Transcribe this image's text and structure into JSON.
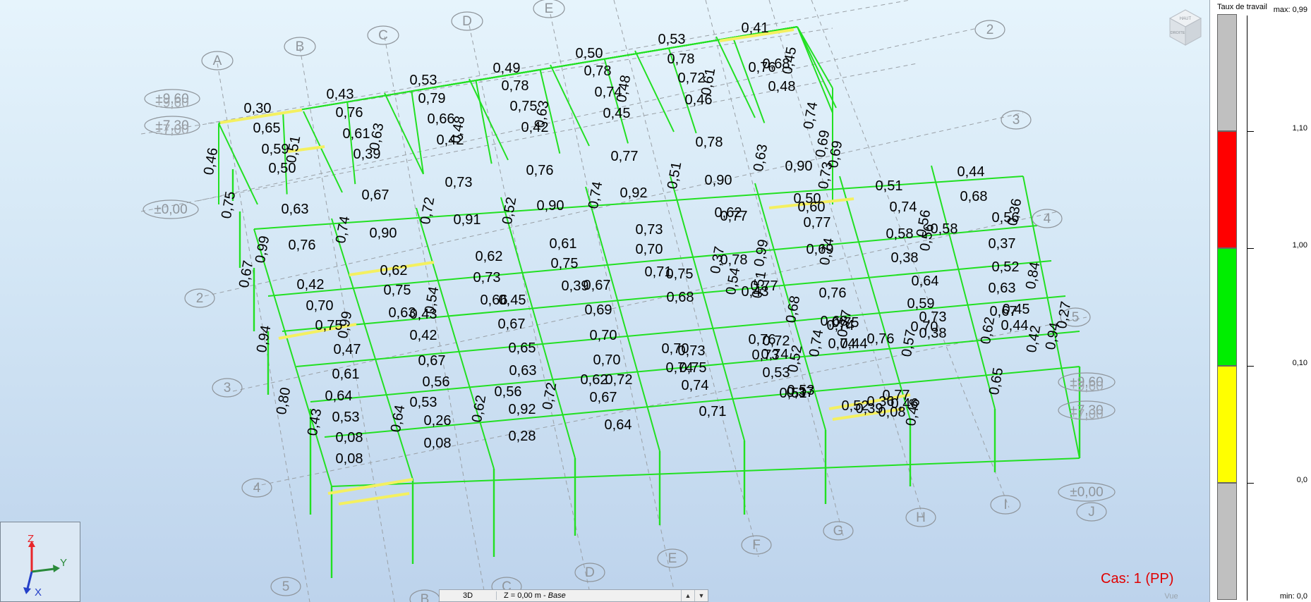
{
  "viewport": {
    "case_label": "Cas: 1 (PP)",
    "view_tab": "Vue",
    "viewcube": {
      "front_face": "DROITE",
      "top_face": "HAUT"
    }
  },
  "status": {
    "mode": "3D",
    "level_prefix": "Z = 0,00 m - ",
    "level_name": "Base"
  },
  "legend": {
    "title": "Taux de travail",
    "max_label": "max: 0,99",
    "min_label": "min: 0,0",
    "ticks": [
      "1,10",
      "1,00",
      "0,10",
      "0,0"
    ],
    "colors": {
      "over": "#ff0000",
      "ok": "#00ee00",
      "low": "#ffff00",
      "neutral": "#c0c0c0"
    }
  },
  "axes": {
    "z": "Z",
    "y": "Y",
    "x": "X"
  },
  "grid_labels": {
    "left_letters": [
      "A",
      "B",
      "C",
      "D",
      "E"
    ],
    "bottom_letters": [
      "B",
      "C",
      "D",
      "E",
      "F",
      "G",
      "H",
      "I",
      "J"
    ],
    "left_numbers": [
      "2",
      "3",
      "4",
      "5"
    ],
    "right_numbers": [
      "2",
      "3",
      "4",
      "5"
    ],
    "level_tags_left": [
      "±9,60",
      "±7,30",
      "±0,00"
    ],
    "level_tags_left_ghost": [
      "±9,60",
      "±7,00"
    ],
    "level_tags_right": [
      "±9,60",
      "±7,30",
      "±0,00"
    ],
    "level_tags_right_ghost": [
      "±9,60",
      "±7,00"
    ]
  },
  "ratios": [
    {
      "t": "0,30"
    },
    {
      "t": "0,43"
    },
    {
      "t": "0,53"
    },
    {
      "t": "0,49"
    },
    {
      "t": "0,50"
    },
    {
      "t": "0,53"
    },
    {
      "t": "0,41"
    },
    {
      "t": "0,65"
    },
    {
      "t": "0,76"
    },
    {
      "t": "0,79"
    },
    {
      "t": "0,78"
    },
    {
      "t": "0,78"
    },
    {
      "t": "0,78"
    },
    {
      "t": "0,76"
    },
    {
      "t": "0,59"
    },
    {
      "t": "0,61"
    },
    {
      "t": "0,66"
    },
    {
      "t": "0,75"
    },
    {
      "t": "0,74"
    },
    {
      "t": "0,72"
    },
    {
      "t": "0,68"
    },
    {
      "t": "0,50"
    },
    {
      "t": "0,39"
    },
    {
      "t": "0,42"
    },
    {
      "t": "0,42"
    },
    {
      "t": "0,45"
    },
    {
      "t": "0,46"
    },
    {
      "t": "0,48"
    },
    {
      "t": "0,51"
    },
    {
      "t": "0,63"
    },
    {
      "t": "0,48"
    },
    {
      "t": "0,63"
    },
    {
      "t": "0,48"
    },
    {
      "t": "0,61"
    },
    {
      "t": "0,45"
    },
    {
      "t": "0,46"
    },
    {
      "t": "0,74"
    },
    {
      "t": "0,69"
    },
    {
      "t": "0,69"
    },
    {
      "t": "0,73"
    },
    {
      "t": "0,76"
    },
    {
      "t": "0,77"
    },
    {
      "t": "0,78"
    },
    {
      "t": "0,63"
    },
    {
      "t": "0,90"
    },
    {
      "t": "0,73"
    },
    {
      "t": "0,75"
    },
    {
      "t": "0,63"
    },
    {
      "t": "0,67"
    },
    {
      "t": "0,72"
    },
    {
      "t": "0,52"
    },
    {
      "t": "0,74"
    },
    {
      "t": "0,92"
    },
    {
      "t": "0,51"
    },
    {
      "t": "0,90"
    },
    {
      "t": "0,99"
    },
    {
      "t": "0,76"
    },
    {
      "t": "0,74"
    },
    {
      "t": "0,90"
    },
    {
      "t": "0,91"
    },
    {
      "t": "0,90"
    },
    {
      "t": "0,62"
    },
    {
      "t": "0,60"
    },
    {
      "t": "0,50"
    },
    {
      "t": "0,51"
    },
    {
      "t": "0,44"
    },
    {
      "t": "0,74"
    },
    {
      "t": "0,68"
    },
    {
      "t": "0,77"
    },
    {
      "t": "0,58"
    },
    {
      "t": "0,56"
    },
    {
      "t": "0,56"
    },
    {
      "t": "0,36"
    },
    {
      "t": "0,67"
    },
    {
      "t": "0,62"
    },
    {
      "t": "0,62"
    },
    {
      "t": "0,61"
    },
    {
      "t": "0,73"
    },
    {
      "t": "0,77"
    },
    {
      "t": "0,69"
    },
    {
      "t": "0,74"
    },
    {
      "t": "0,38"
    },
    {
      "t": "0,37"
    },
    {
      "t": "0,42"
    },
    {
      "t": "0,75"
    },
    {
      "t": "0,73"
    },
    {
      "t": "0,75"
    },
    {
      "t": "0,70"
    },
    {
      "t": "0,37"
    },
    {
      "t": "0,78"
    },
    {
      "t": "0,99"
    },
    {
      "t": "0,56"
    },
    {
      "t": "0,58"
    },
    {
      "t": "0,70"
    },
    {
      "t": "0,63"
    },
    {
      "t": "0,66"
    },
    {
      "t": "0,39"
    },
    {
      "t": "0,71"
    },
    {
      "t": "0,54"
    },
    {
      "t": "0,43"
    },
    {
      "t": "0,51"
    },
    {
      "t": "0,76"
    },
    {
      "t": "0,64"
    },
    {
      "t": "0,52"
    },
    {
      "t": "0,84"
    },
    {
      "t": "0,94"
    },
    {
      "t": "0,75"
    },
    {
      "t": "0,99"
    },
    {
      "t": "0,54"
    },
    {
      "t": "0,43"
    },
    {
      "t": "0,45"
    },
    {
      "t": "0,67"
    },
    {
      "t": "0,75"
    },
    {
      "t": "0,68"
    },
    {
      "t": "0,59"
    },
    {
      "t": "0,63"
    },
    {
      "t": "0,27"
    },
    {
      "t": "0,47"
    },
    {
      "t": "0,42"
    },
    {
      "t": "0,67"
    },
    {
      "t": "0,69"
    },
    {
      "t": "0,68"
    },
    {
      "t": "0,77"
    },
    {
      "t": "0,74"
    },
    {
      "t": "0,70"
    },
    {
      "t": "0,67"
    },
    {
      "t": "0,94"
    },
    {
      "t": "0,80"
    },
    {
      "t": "0,61"
    },
    {
      "t": "0,67"
    },
    {
      "t": "0,65"
    },
    {
      "t": "0,70"
    },
    {
      "t": "0,70"
    },
    {
      "t": "0,76"
    },
    {
      "t": "0,74"
    },
    {
      "t": "0,74"
    },
    {
      "t": "0,68"
    },
    {
      "t": "0,57"
    },
    {
      "t": "0,62"
    },
    {
      "t": "0,64"
    },
    {
      "t": "0,56"
    },
    {
      "t": "0,63"
    },
    {
      "t": "0,70"
    },
    {
      "t": "0,73"
    },
    {
      "t": "0,72"
    },
    {
      "t": "0,75"
    },
    {
      "t": "0,73"
    },
    {
      "t": "0,45"
    },
    {
      "t": "0,42"
    },
    {
      "t": "0,43"
    },
    {
      "t": "0,64"
    },
    {
      "t": "0,62"
    },
    {
      "t": "0,72"
    },
    {
      "t": "0,72"
    },
    {
      "t": "0,75"
    },
    {
      "t": "0,74"
    },
    {
      "t": "0,44"
    },
    {
      "t": "0,38"
    },
    {
      "t": "0,44"
    },
    {
      "t": "0,65"
    },
    {
      "t": "0,53"
    },
    {
      "t": "0,53"
    },
    {
      "t": "0,56"
    },
    {
      "t": "0,62"
    },
    {
      "t": "0,74"
    },
    {
      "t": "0,73"
    },
    {
      "t": "0,77"
    },
    {
      "t": "0,53"
    },
    {
      "t": "0,08"
    },
    {
      "t": "0,08"
    },
    {
      "t": "0,26"
    },
    {
      "t": "0,92"
    },
    {
      "t": "0,67"
    },
    {
      "t": "0,74"
    },
    {
      "t": "0,53"
    },
    {
      "t": "0,52"
    },
    {
      "t": "0,76"
    },
    {
      "t": "0,77"
    },
    {
      "t": "0,46"
    },
    {
      "t": "0,46"
    },
    {
      "t": "0,39"
    },
    {
      "t": "0,08"
    },
    {
      "t": "0,08"
    },
    {
      "t": "0,28"
    },
    {
      "t": "0,64"
    },
    {
      "t": "0,71"
    },
    {
      "t": "0,51"
    },
    {
      "t": "0,37"
    },
    {
      "t": "0,52"
    },
    {
      "t": "0,36"
    }
  ]
}
